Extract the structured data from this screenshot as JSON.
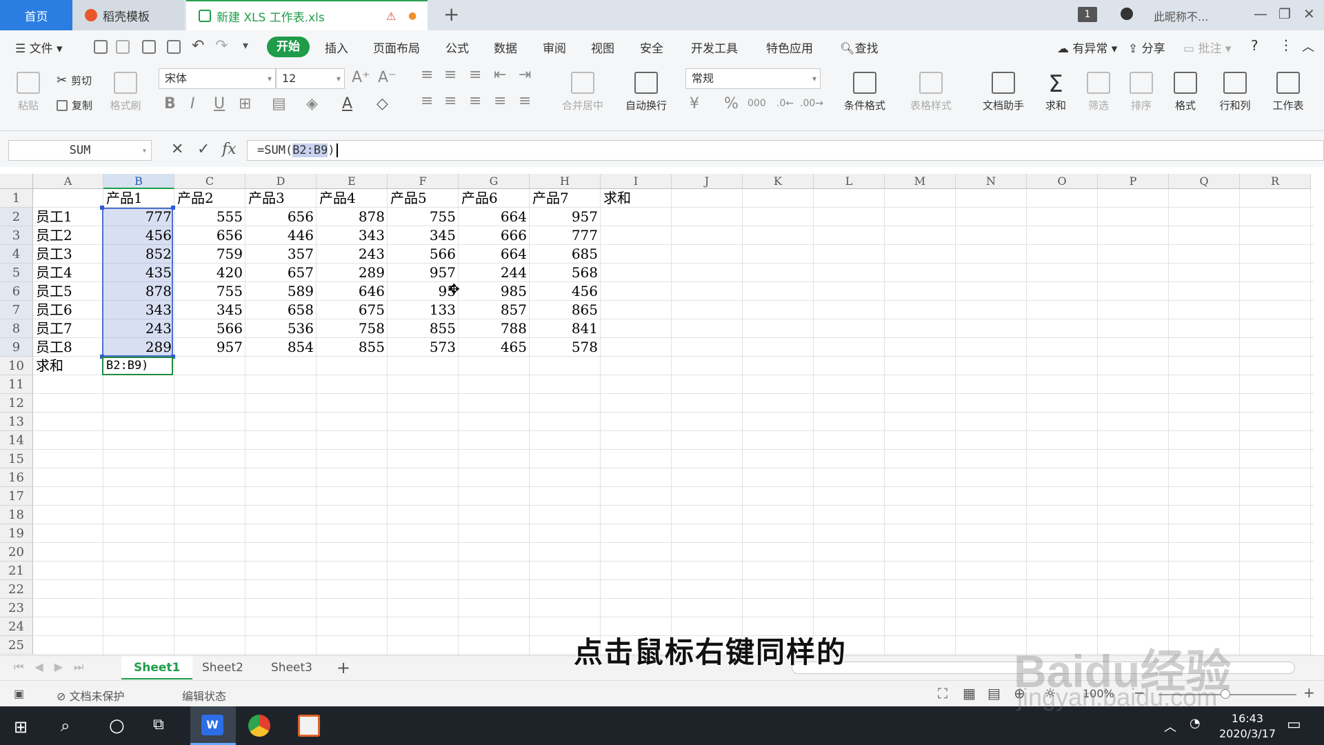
{
  "titlebar": {
    "tab_home": "首页",
    "tab_template": "稻壳模板",
    "tab_doc": "新建 XLS 工作表.xls",
    "warning_icon": "warning-icon",
    "new_tab": "+",
    "page_badge": "1",
    "user_name": "此昵称不...",
    "accent_color": "#1e9e4a",
    "home_color": "#2a7de1"
  },
  "menubar": {
    "file": "文件",
    "start": "开始",
    "items": [
      "插入",
      "页面布局",
      "公式",
      "数据",
      "审阅",
      "视图",
      "安全",
      "开发工具",
      "特色应用"
    ],
    "search": "查找",
    "exception": "有异常",
    "share": "分享",
    "comment": "批注",
    "help": "?"
  },
  "ribbon": {
    "paste": "粘贴",
    "cut": "剪切",
    "copy": "复制",
    "format_painter": "格式刷",
    "font_name": "宋体",
    "font_size": "12",
    "merge_center": "合并居中",
    "wrap_text": "自动换行",
    "number_format": "常规",
    "percent": "%",
    "thousand": "000",
    "cond_format": "条件格式",
    "table_style": "表格样式",
    "doc_assistant": "文档助手",
    "sum": "求和",
    "filter": "筛选",
    "sort": "排序",
    "format": "格式",
    "row_col": "行和列",
    "worksheet": "工作表"
  },
  "formulabar": {
    "name_box": "SUM",
    "fx": "fx",
    "formula_prefix": "=SUM(",
    "formula_ref": "B2:B9",
    "formula_suffix": ")"
  },
  "sheet": {
    "columns": [
      "A",
      "B",
      "C",
      "D",
      "E",
      "F",
      "G",
      "H",
      "I",
      "J",
      "K",
      "L",
      "M",
      "N",
      "O",
      "P",
      "Q",
      "R"
    ],
    "rows": [
      "1",
      "2",
      "3",
      "4",
      "5",
      "6",
      "7",
      "8",
      "9",
      "10",
      "11",
      "12",
      "13",
      "14",
      "15",
      "16",
      "17",
      "18",
      "19",
      "20",
      "21",
      "22",
      "23",
      "24",
      "25"
    ],
    "header": [
      "",
      "产品1",
      "产品2",
      "产品3",
      "产品4",
      "产品5",
      "产品6",
      "产品7",
      "求和"
    ],
    "data": [
      [
        "员工1",
        "777",
        "555",
        "656",
        "878",
        "755",
        "664",
        "957"
      ],
      [
        "员工2",
        "456",
        "656",
        "446",
        "343",
        "345",
        "666",
        "777"
      ],
      [
        "员工3",
        "852",
        "759",
        "357",
        "243",
        "566",
        "664",
        "685"
      ],
      [
        "员工4",
        "435",
        "420",
        "657",
        "289",
        "957",
        "244",
        "568"
      ],
      [
        "员工5",
        "878",
        "755",
        "589",
        "646",
        "95",
        "985",
        "456"
      ],
      [
        "员工6",
        "343",
        "345",
        "658",
        "675",
        "133",
        "857",
        "865"
      ],
      [
        "员工7",
        "243",
        "566",
        "536",
        "758",
        "855",
        "788",
        "841"
      ],
      [
        "员工8",
        "289",
        "957",
        "854",
        "855",
        "573",
        "465",
        "578"
      ]
    ],
    "row10_label": "求和",
    "row10_edit": "B2:B9)"
  },
  "sheet_tabs": [
    "Sheet1",
    "Sheet2",
    "Sheet3"
  ],
  "add_sheet": "+",
  "status": {
    "protect": "文档未保护",
    "mode": "编辑状态",
    "zoom": "100%"
  },
  "taskbar": {
    "time": "16:43",
    "date": "2020/3/17"
  },
  "caption": "点击鼠标右键同样的",
  "watermark": "Baidu经验",
  "watermark_url": "jingyan.baidu.com"
}
